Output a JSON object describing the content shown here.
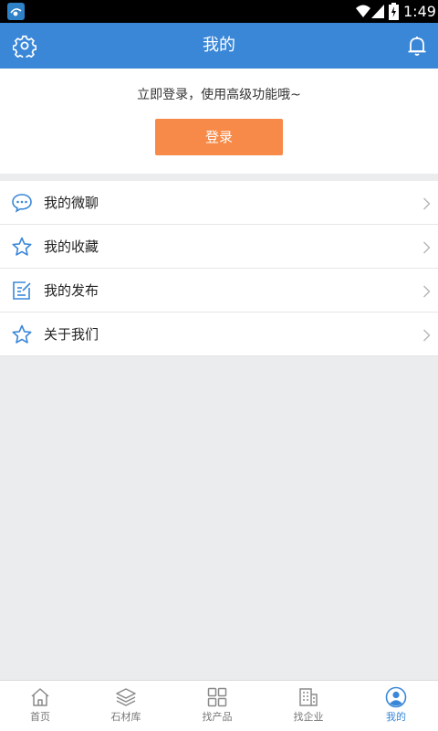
{
  "status_bar": {
    "time": "1:49"
  },
  "header": {
    "title": "我的"
  },
  "login": {
    "prompt": "立即登录，使用高级功能哦~",
    "button_label": "登录",
    "button_color": "#f78a48"
  },
  "menu": {
    "items": [
      {
        "label": "我的微聊",
        "icon": "chat-bubble-icon"
      },
      {
        "label": "我的收藏",
        "icon": "star-icon"
      },
      {
        "label": "我的发布",
        "icon": "edit-icon"
      },
      {
        "label": "关于我们",
        "icon": "star-icon"
      }
    ]
  },
  "bottom_nav": {
    "tabs": [
      {
        "label": "首页",
        "icon": "home-icon",
        "active": false
      },
      {
        "label": "石材库",
        "icon": "layers-icon",
        "active": false
      },
      {
        "label": "找产品",
        "icon": "grid-icon",
        "active": false
      },
      {
        "label": "找企业",
        "icon": "building-icon",
        "active": false
      },
      {
        "label": "我的",
        "icon": "user-icon",
        "active": true
      }
    ]
  },
  "colors": {
    "accent": "#3a87d8",
    "background": "#ebecee",
    "login_button": "#f78a48"
  }
}
